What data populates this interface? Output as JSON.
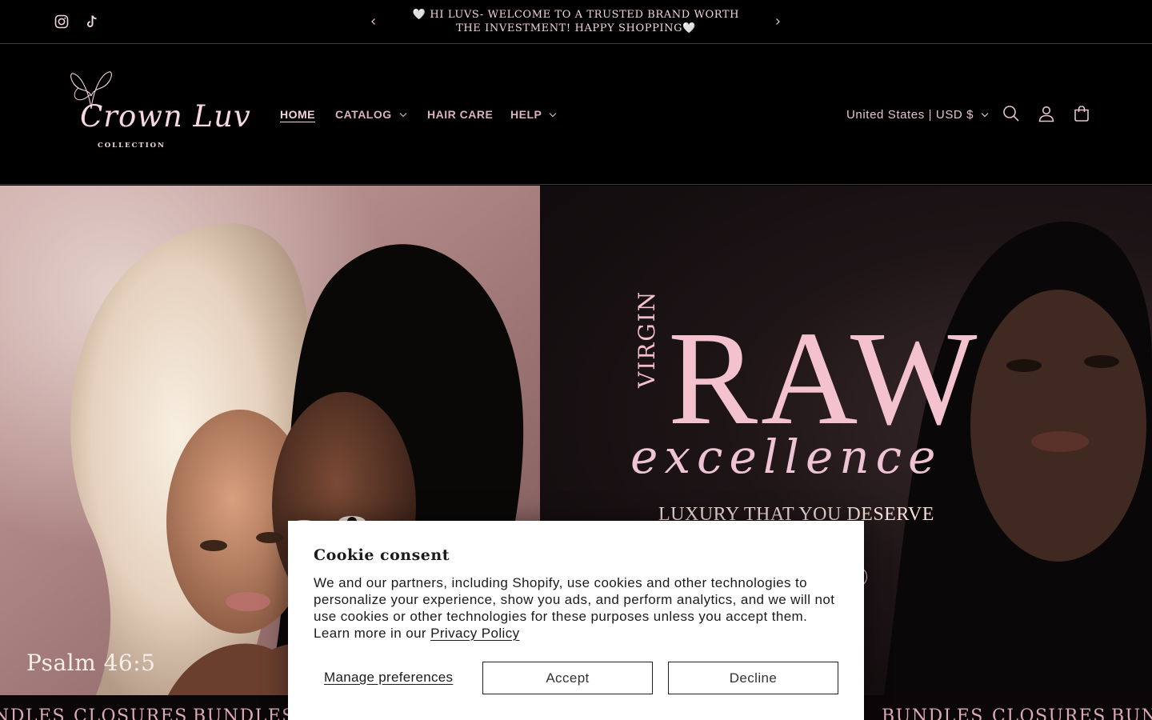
{
  "announcement": {
    "text": "🤍 HI LUVS- WELCOME TO A TRUSTED BRAND WORTH THE INVESTMENT! HAPPY SHOPPING🤍",
    "social": [
      "instagram-icon",
      "tiktok-icon"
    ],
    "prev_icon": "chevron-left-icon",
    "next_icon": "chevron-right-icon"
  },
  "header": {
    "logo": {
      "script": "Crown Luv",
      "subtitle": "COLLECTION"
    },
    "nav": [
      {
        "label": "HOME",
        "active": true
      },
      {
        "label": "CATALOG",
        "dropdown": true
      },
      {
        "label": "HAIR CARE"
      },
      {
        "label": "HELP",
        "dropdown": true
      }
    ],
    "locale": "United States | USD $",
    "icons": [
      "search-icon",
      "account-icon",
      "cart-icon"
    ]
  },
  "hero": {
    "left_caption": "Psalm 46:5",
    "right": {
      "virgin": "VIRGIN",
      "raw": "RAW",
      "excellence": "excellence",
      "tagline": "LUXURY THAT YOU DESERVE"
    }
  },
  "marquee": {
    "items": [
      "NDLES",
      "CLOSURES",
      "BUNDLES",
      "BUNDLES",
      "CLOSURES",
      "BUNI"
    ]
  },
  "cookie": {
    "title": "Cookie consent",
    "body": "We and our partners, including Shopify, use cookies and other technologies to personalize your experience, show you ads, and perform analytics, and we will not use cookies or other technologies for these purposes unless you accept them. Learn more in our",
    "link": "Privacy Policy",
    "manage": "Manage preferences",
    "accept": "Accept",
    "decline": "Decline"
  },
  "colors": {
    "accent": "#F3D4DC",
    "nav_text": "#DCB2BF",
    "background": "#000000",
    "modal": "#FFFFFF"
  }
}
